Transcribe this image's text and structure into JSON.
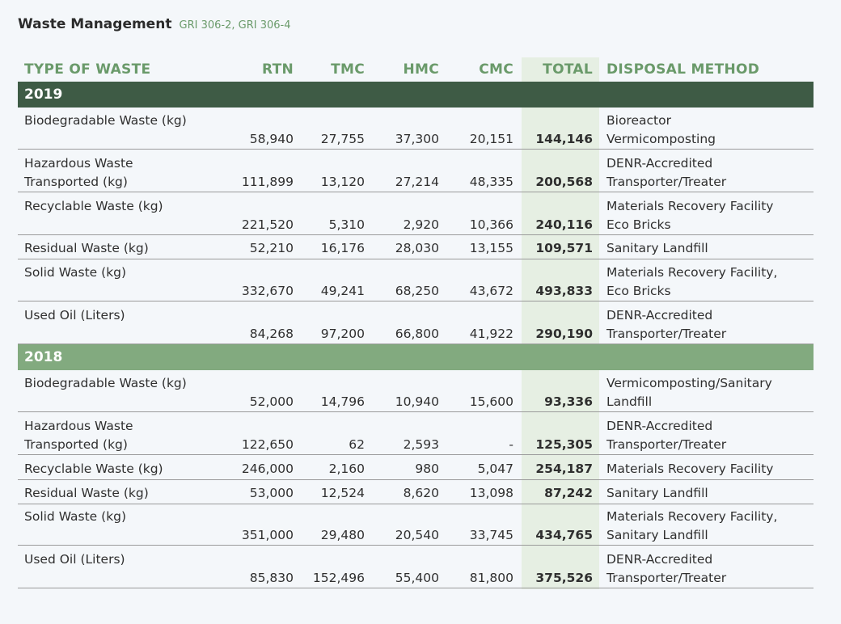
{
  "title": "Waste Management",
  "subtitle": "GRI 306-2, GRI 306-4",
  "columns": {
    "type": "TYPE OF WASTE",
    "rtn": "RTN",
    "tmc": "TMC",
    "hmc": "HMC",
    "cmc": "CMC",
    "total": "TOTAL",
    "disposal": "DISPOSAL METHOD"
  },
  "sections": [
    {
      "year": "2019",
      "rows": [
        {
          "type_l1": "Biodegradable Waste (kg)",
          "type_l2": "",
          "rtn": "58,940",
          "tmc": "27,755",
          "hmc": "37,300",
          "cmc": "20,151",
          "total": "144,146",
          "disp_l1": "Bioreactor",
          "disp_l2": "Vermicomposting"
        },
        {
          "type_l1": "Hazardous Waste",
          "type_l2": "Transported (kg)",
          "rtn": "111,899",
          "tmc": "13,120",
          "hmc": "27,214",
          "cmc": "48,335",
          "total": "200,568",
          "disp_l1": "DENR-Accredited",
          "disp_l2": "Transporter/Treater"
        },
        {
          "type_l1": "Recyclable Waste (kg)",
          "type_l2": "",
          "rtn": "221,520",
          "tmc": "5,310",
          "hmc": "2,920",
          "cmc": "10,366",
          "total": "240,116",
          "disp_l1": "Materials Recovery Facility",
          "disp_l2": "Eco Bricks"
        },
        {
          "type_l1": "Residual Waste (kg)",
          "type_l2": "",
          "rtn": "52,210",
          "tmc": "16,176",
          "hmc": "28,030",
          "cmc": "13,155",
          "total": "109,571",
          "disp_l1": "Sanitary Landfill",
          "disp_l2": ""
        },
        {
          "type_l1": "Solid Waste (kg)",
          "type_l2": "",
          "rtn": "332,670",
          "tmc": "49,241",
          "hmc": "68,250",
          "cmc": "43,672",
          "total": "493,833",
          "disp_l1": "Materials Recovery Facility,",
          "disp_l2": "Eco Bricks"
        },
        {
          "type_l1": "Used Oil (Liters)",
          "type_l2": "",
          "rtn": "84,268",
          "tmc": "97,200",
          "hmc": "66,800",
          "cmc": "41,922",
          "total": "290,190",
          "disp_l1": "DENR-Accredited",
          "disp_l2": "Transporter/Treater"
        }
      ]
    },
    {
      "year": "2018",
      "rows": [
        {
          "type_l1": "Biodegradable Waste (kg)",
          "type_l2": "",
          "rtn": "52,000",
          "tmc": "14,796",
          "hmc": "10,940",
          "cmc": "15,600",
          "total": "93,336",
          "disp_l1": "Vermicomposting/Sanitary",
          "disp_l2": "Landfill"
        },
        {
          "type_l1": "Hazardous Waste",
          "type_l2": "Transported (kg)",
          "rtn": "122,650",
          "tmc": "62",
          "hmc": "2,593",
          "cmc": "-",
          "total": "125,305",
          "disp_l1": "DENR-Accredited",
          "disp_l2": "Transporter/Treater"
        },
        {
          "type_l1": "Recyclable Waste (kg)",
          "type_l2": "",
          "rtn": "246,000",
          "tmc": "2,160",
          "hmc": "980",
          "cmc": "5,047",
          "total": "254,187",
          "disp_l1": "Materials Recovery Facility",
          "disp_l2": ""
        },
        {
          "type_l1": "Residual Waste (kg)",
          "type_l2": "",
          "rtn": "53,000",
          "tmc": "12,524",
          "hmc": "8,620",
          "cmc": "13,098",
          "total": "87,242",
          "disp_l1": "Sanitary Landfill",
          "disp_l2": ""
        },
        {
          "type_l1": "Solid Waste (kg)",
          "type_l2": "",
          "rtn": "351,000",
          "tmc": "29,480",
          "hmc": "20,540",
          "cmc": "33,745",
          "total": "434,765",
          "disp_l1": "Materials Recovery Facility,",
          "disp_l2": "Sanitary Landfill"
        },
        {
          "type_l1": "Used Oil (Liters)",
          "type_l2": "",
          "rtn": "85,830",
          "tmc": "152,496",
          "hmc": "55,400",
          "cmc": "81,800",
          "total": "375,526",
          "disp_l1": "DENR-Accredited",
          "disp_l2": "Transporter/Treater"
        }
      ]
    }
  ]
}
